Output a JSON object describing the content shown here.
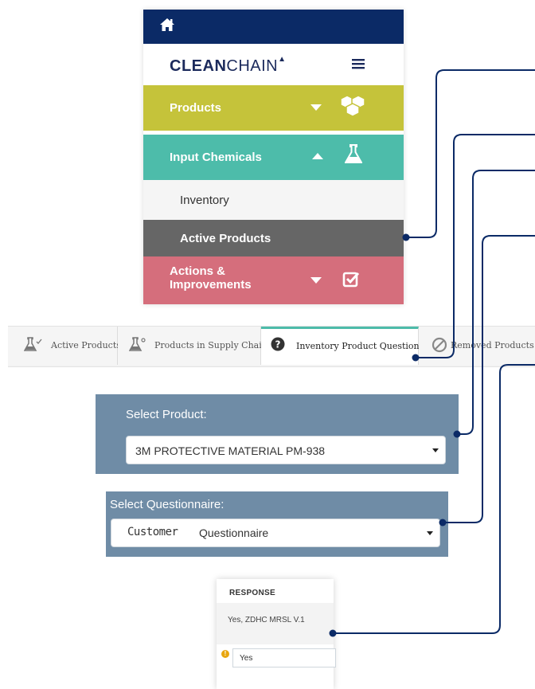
{
  "nav": {
    "brand_bold": "CLEAN",
    "brand_light": "CHAIN",
    "brand_mark": "▲",
    "sections": {
      "products": "Products",
      "input_chemicals": "Input Chemicals",
      "inventory": "Inventory",
      "active_products": "Active Products",
      "actions_line1": "Actions &",
      "actions_line2": "Improvements"
    }
  },
  "tabs": [
    {
      "label": "Active Products"
    },
    {
      "label": "Products in Supply Chain"
    },
    {
      "label": "Inventory Product Questions"
    },
    {
      "label": "Removed Products"
    }
  ],
  "product_select": {
    "label": "Select Product:",
    "value": "3M PROTECTIVE MATERIAL PM-938"
  },
  "questionnaire_select": {
    "label": "Select Questionnaire:",
    "value_part1": "Customer",
    "value_part2": "Questionnaire"
  },
  "response": {
    "header": "RESPONSE",
    "row_text": "Yes, ZDHC MRSL V.1",
    "input_value": "Yes",
    "warn_glyph": "!"
  },
  "colors": {
    "navy": "#0b2a66",
    "products": "#c5c33a",
    "input_chemicals": "#4dbcaa",
    "active": "#666666",
    "actions": "#d56e7c",
    "panel": "#6f8ca6",
    "connector": "#0b2a66"
  },
  "icons": [
    "home-icon",
    "menu-icon",
    "cubes-icon",
    "flask-icon",
    "check-square-icon",
    "question-circle-icon",
    "ban-icon"
  ]
}
